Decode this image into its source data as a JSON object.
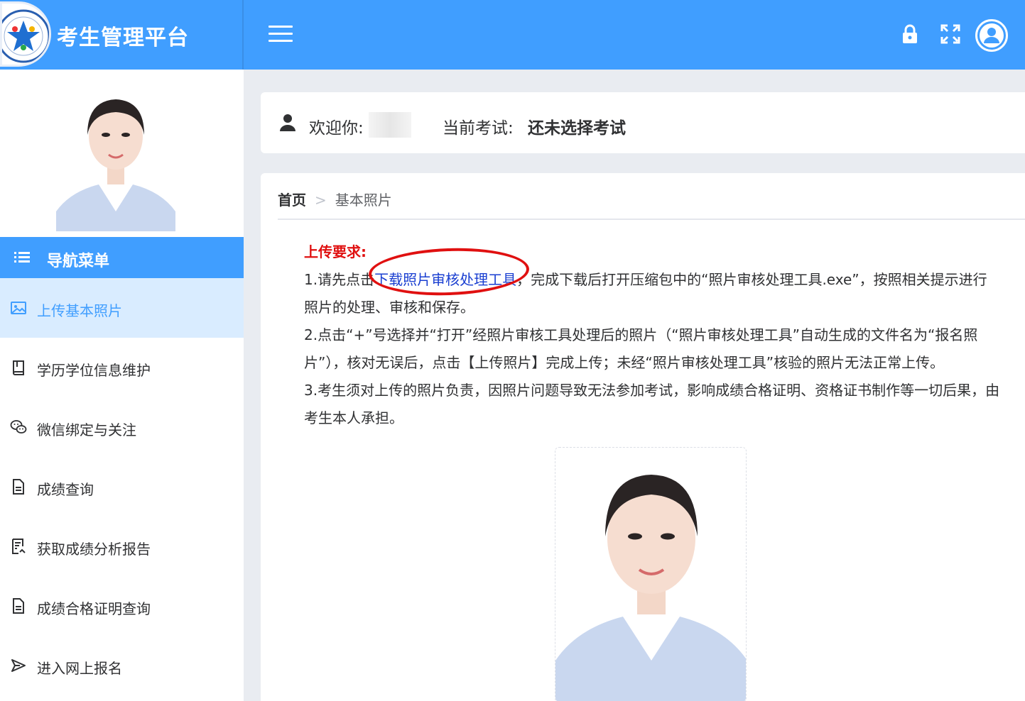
{
  "header": {
    "title": "考生管理平台",
    "icons": [
      "lock-icon",
      "fullscreen-icon",
      "user-avatar-icon"
    ]
  },
  "sidebar": {
    "nav_title": "导航菜单",
    "items": [
      {
        "label": "上传基本照片",
        "icon": "image-icon",
        "active": true
      },
      {
        "label": "学历学位信息维护",
        "icon": "book-icon"
      },
      {
        "label": "微信绑定与关注",
        "icon": "wechat-icon"
      },
      {
        "label": "成绩查询",
        "icon": "document-icon"
      },
      {
        "label": "获取成绩分析报告",
        "icon": "report-icon"
      },
      {
        "label": "成绩合格证明查询",
        "icon": "document-icon"
      },
      {
        "label": "进入网上报名",
        "icon": "send-icon"
      }
    ]
  },
  "welcome": {
    "greeting": "欢迎你:",
    "exam_label": "当前考试:",
    "exam_value": "还未选择考试"
  },
  "breadcrumb": {
    "home": "首页",
    "current": "基本照片"
  },
  "requirements": {
    "title": "上传要求:",
    "line1_prefix": "1.请先点击",
    "line1_link": "下载照片审核处理工具",
    "line1_suffix": "，完成下载后打开压缩包中的“照片审核处理工具.exe”，按照相关提示进行照片的处理、审核和保存。",
    "line2": "2.点击“+”号选择并“打开”经照片审核工具处理后的照片（“照片审核处理工具”自动生成的文件名为“报名照片”），核对无误后，点击【上传照片】完成上传；未经“照片审核处理工具”核验的照片无法正常上传。",
    "line3": "3.考生须对上传的照片负责，因照片问题导致无法参加考试，影响成绩合格证明、资格证书制作等一切后果，由考生本人承担。"
  },
  "colors": {
    "primary": "#409eff",
    "active_bg": "#d9ecff",
    "requirement_title": "#e01010",
    "link": "#1a3fd1"
  }
}
